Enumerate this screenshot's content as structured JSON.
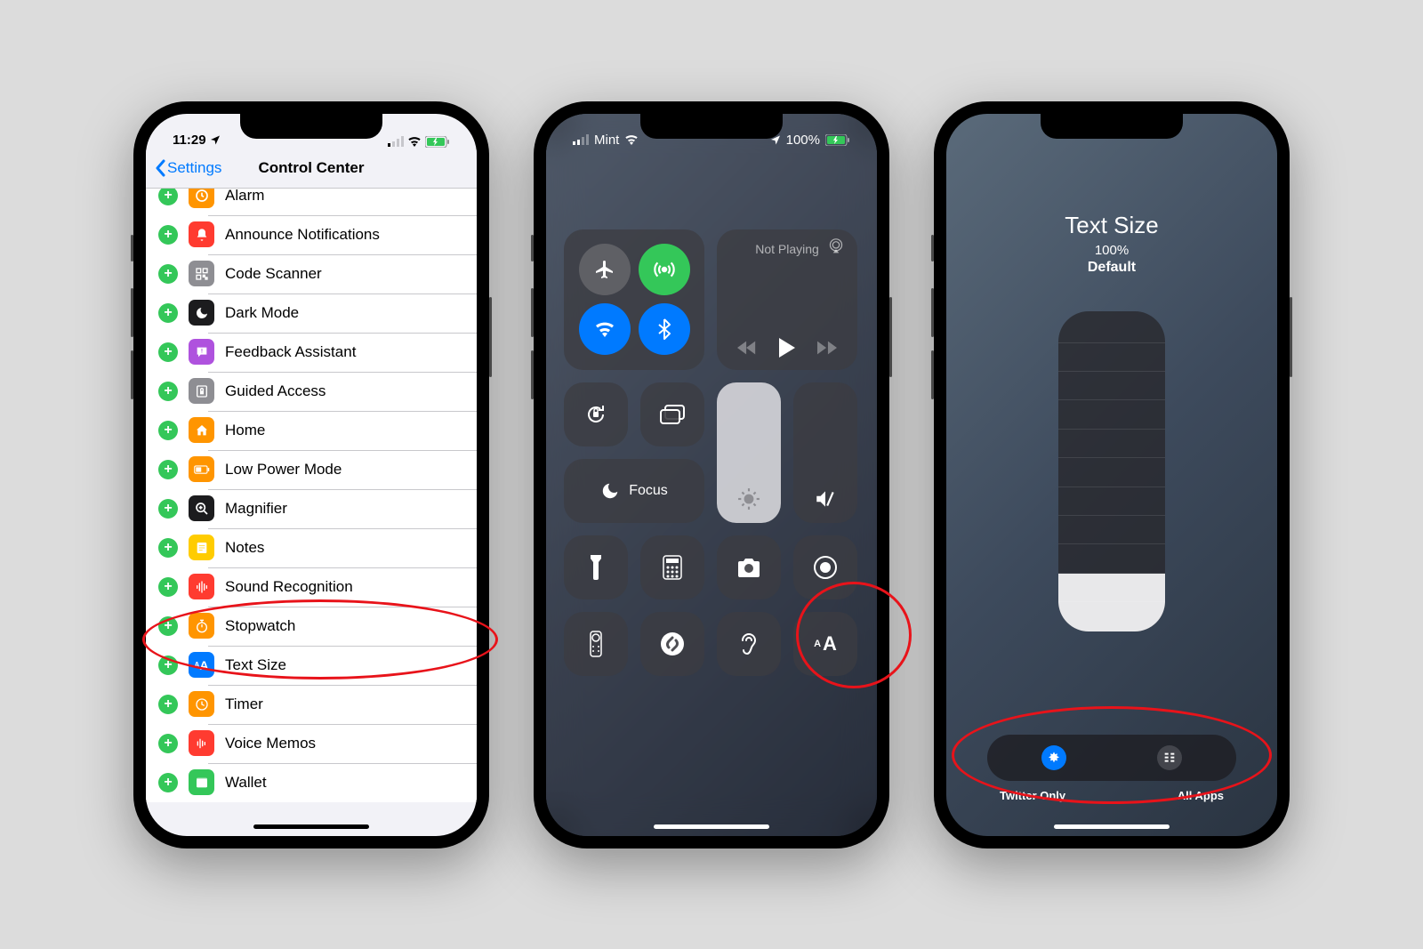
{
  "phone1": {
    "status": {
      "time": "11:29",
      "send_icon": "✈︎"
    },
    "nav": {
      "back": "Settings",
      "title": "Control Center"
    },
    "rows": [
      {
        "label": "Alarm",
        "icon_bg": "#ff9500",
        "icon": "clock"
      },
      {
        "label": "Announce Notifications",
        "icon_bg": "#ff3b30",
        "icon": "bell"
      },
      {
        "label": "Code Scanner",
        "icon_bg": "#8e8e93",
        "icon": "qr"
      },
      {
        "label": "Dark Mode",
        "icon_bg": "#1c1c1e",
        "icon": "moon"
      },
      {
        "label": "Feedback Assistant",
        "icon_bg": "#af52de",
        "icon": "bubble"
      },
      {
        "label": "Guided Access",
        "icon_bg": "#8e8e93",
        "icon": "lock"
      },
      {
        "label": "Home",
        "icon_bg": "#ff9500",
        "icon": "home"
      },
      {
        "label": "Low Power Mode",
        "icon_bg": "#ff9500",
        "icon": "battery"
      },
      {
        "label": "Magnifier",
        "icon_bg": "#1c1c1e",
        "icon": "magnify"
      },
      {
        "label": "Notes",
        "icon_bg": "#ffcc00",
        "icon": "notes"
      },
      {
        "label": "Sound Recognition",
        "icon_bg": "#ff3b30",
        "icon": "sound"
      },
      {
        "label": "Stopwatch",
        "icon_bg": "#ff9500",
        "icon": "stopwatch"
      },
      {
        "label": "Text Size",
        "icon_bg": "#007aff",
        "icon": "textsize"
      },
      {
        "label": "Timer",
        "icon_bg": "#ff9500",
        "icon": "timer"
      },
      {
        "label": "Voice Memos",
        "icon_bg": "#ff3b30",
        "icon": "voice"
      },
      {
        "label": "Wallet",
        "icon_bg": "#34c759",
        "icon": "wallet"
      }
    ]
  },
  "phone2": {
    "status": {
      "carrier": "Mint",
      "battery": "100%"
    },
    "media": {
      "label": "Not Playing"
    },
    "focus": {
      "label": "Focus"
    }
  },
  "phone3": {
    "title": "Text Size",
    "percent": "100%",
    "subtitle": "Default",
    "scope": {
      "left": "Twitter Only",
      "right": "All Apps"
    }
  }
}
